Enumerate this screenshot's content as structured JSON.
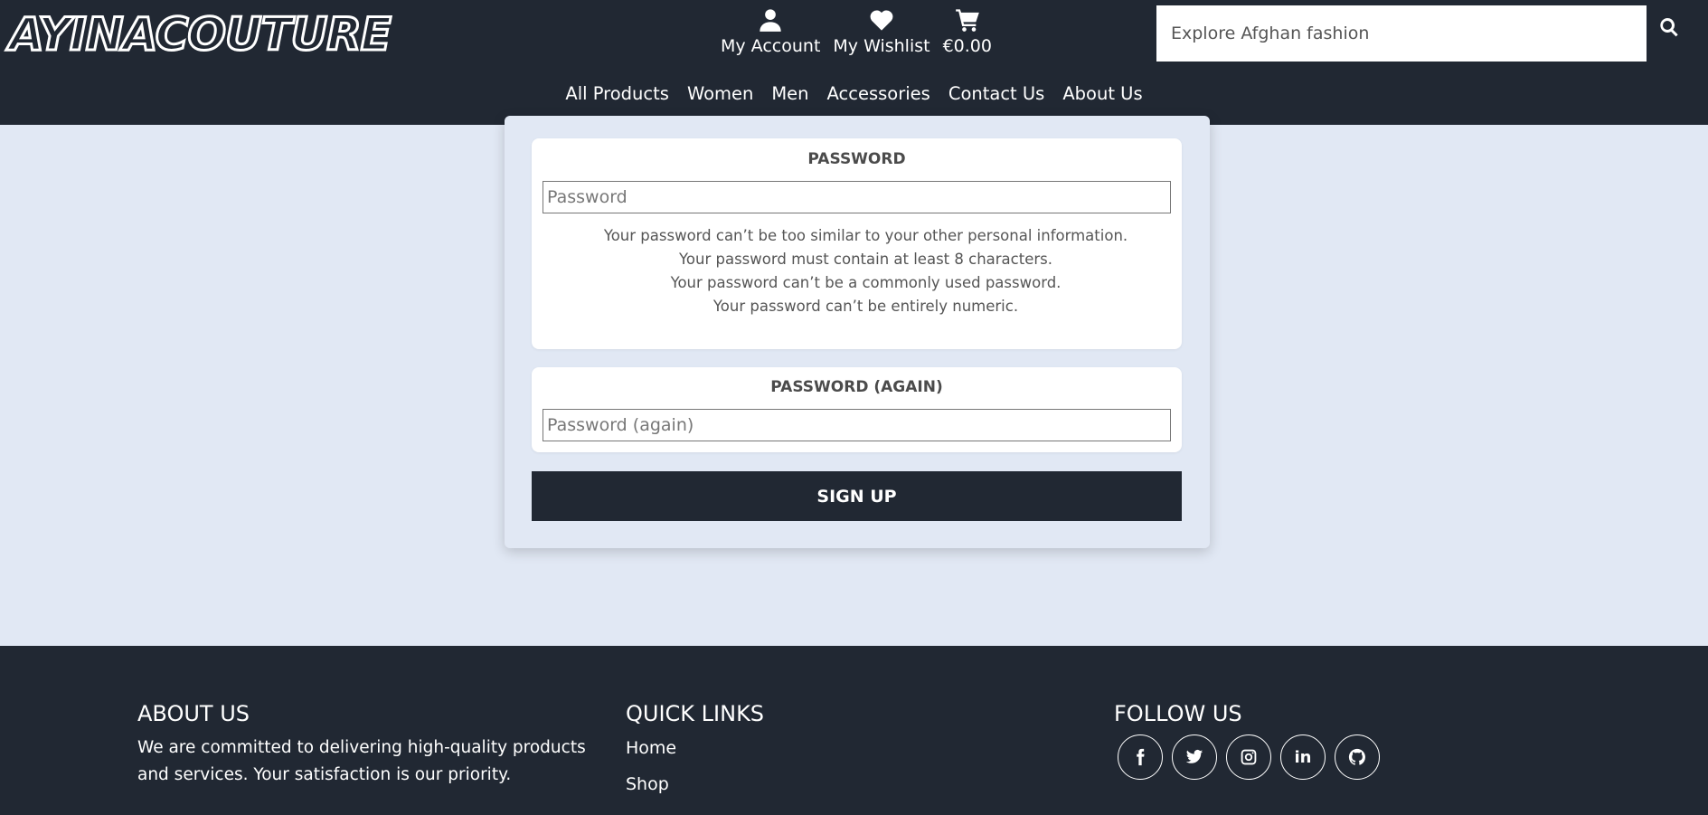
{
  "header": {
    "logo_text": "AYINACOUTURE",
    "account_label": "My Account",
    "wishlist_label": "My Wishlist",
    "cart_total": "€0.00",
    "search_placeholder": "Explore Afghan fashion",
    "icons": {
      "account": "user-icon",
      "wishlist": "heart-icon",
      "cart": "cart-icon",
      "search": "search-icon"
    }
  },
  "nav": {
    "items": [
      {
        "label": "All Products"
      },
      {
        "label": "Women"
      },
      {
        "label": "Men"
      },
      {
        "label": "Accessories"
      },
      {
        "label": "Contact Us"
      },
      {
        "label": "About Us"
      }
    ]
  },
  "form": {
    "password": {
      "label": "PASSWORD",
      "placeholder": "Password",
      "help": [
        "Your password can’t be too similar to your other personal information.",
        "Your password must contain at least 8 characters.",
        "Your password can’t be a commonly used password.",
        "Your password can’t be entirely numeric."
      ]
    },
    "password_again": {
      "label": "PASSWORD (AGAIN)",
      "placeholder": "Password (again)"
    },
    "submit_label": "SIGN UP"
  },
  "footer": {
    "about": {
      "title": "ABOUT US",
      "text": "We are committed to delivering high-quality products and services. Your satisfaction is our priority."
    },
    "quick_links": {
      "title": "QUICK LINKS",
      "items": [
        {
          "label": "Home"
        },
        {
          "label": "Shop"
        }
      ]
    },
    "follow": {
      "title": "FOLLOW US",
      "icons": [
        "facebook-icon",
        "twitter-icon",
        "instagram-icon",
        "linkedin-icon",
        "github-icon"
      ],
      "linkedin_text": "in"
    }
  },
  "colors": {
    "dark": "#212833",
    "background": "#e1e8f4",
    "card": "#ffffff"
  }
}
